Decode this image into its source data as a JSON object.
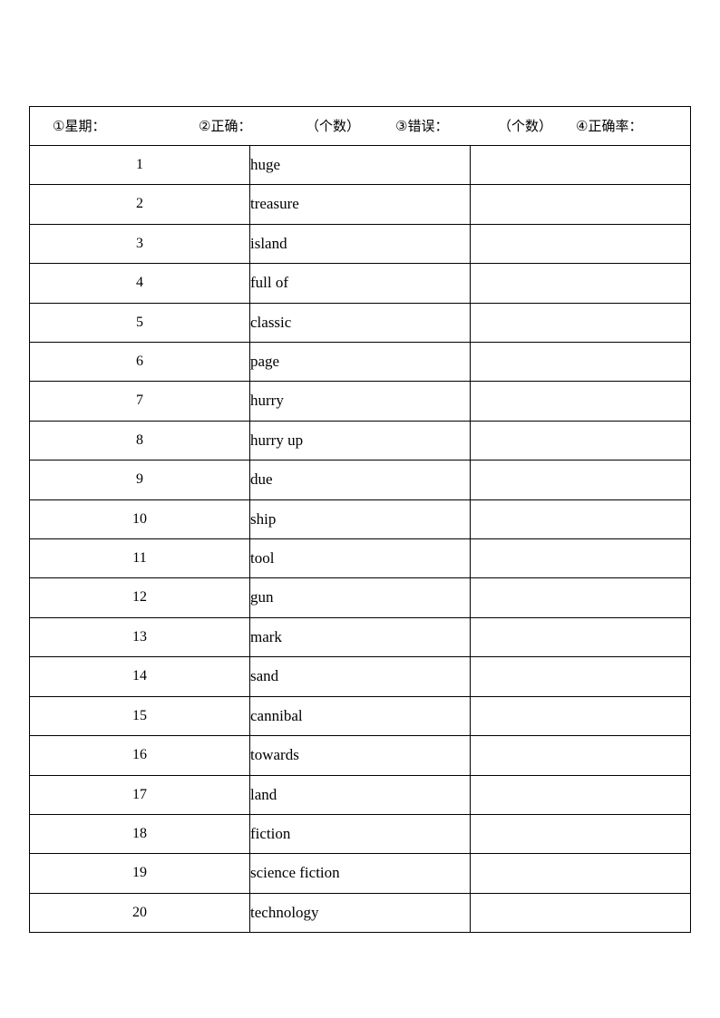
{
  "document": {
    "type": "vocabulary-practice-worksheet",
    "header": {
      "segments": [
        {
          "name": "week",
          "text": "①星期："
        },
        {
          "name": "correct",
          "text": "②正确："
        },
        {
          "name": "count-1",
          "text": "（个数）"
        },
        {
          "name": "wrong",
          "text": "③错误："
        },
        {
          "name": "count-2",
          "text": "（个数）"
        },
        {
          "name": "accuracy",
          "text": "④正确率："
        }
      ]
    },
    "rows": [
      {
        "num": "1",
        "word": "huge"
      },
      {
        "num": "2",
        "word": "treasure"
      },
      {
        "num": "3",
        "word": "island"
      },
      {
        "num": "4",
        "word": "full of"
      },
      {
        "num": "5",
        "word": "classic"
      },
      {
        "num": "6",
        "word": "page"
      },
      {
        "num": "7",
        "word": "hurry"
      },
      {
        "num": "8",
        "word": "hurry up"
      },
      {
        "num": "9",
        "word": "due"
      },
      {
        "num": "10",
        "word": "ship"
      },
      {
        "num": "11",
        "word": "tool"
      },
      {
        "num": "12",
        "word": "gun"
      },
      {
        "num": "13",
        "word": "mark"
      },
      {
        "num": "14",
        "word": "sand"
      },
      {
        "num": "15",
        "word": "cannibal"
      },
      {
        "num": "16",
        "word": "towards"
      },
      {
        "num": "17",
        "word": "land"
      },
      {
        "num": "18",
        "word": "fiction"
      },
      {
        "num": "19",
        "word": "science fiction"
      },
      {
        "num": "20",
        "word": "technology"
      }
    ],
    "answer_column": {
      "name": "answer-blank",
      "text": ""
    },
    "colors": {
      "border": "#000000",
      "text": "#000000",
      "background": "#ffffff"
    }
  }
}
